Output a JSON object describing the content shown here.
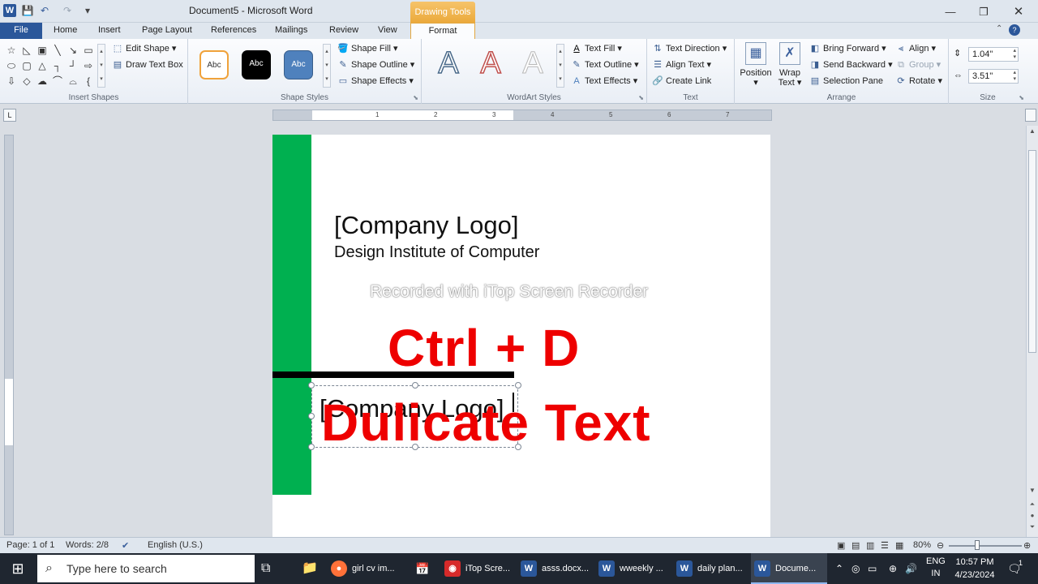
{
  "window": {
    "title": "Document5  -  Microsoft Word",
    "context_tab": "Drawing Tools",
    "minimize": "—",
    "maximize": "❐",
    "close": "✕"
  },
  "tabs": [
    "File",
    "Home",
    "Insert",
    "Page Layout",
    "References",
    "Mailings",
    "Review",
    "View",
    "Format"
  ],
  "ribbon": {
    "insert_shapes": {
      "label": "Insert Shapes",
      "edit_shape": "Edit Shape",
      "draw_text_box": "Draw Text Box"
    },
    "shape_styles": {
      "label": "Shape Styles",
      "sample": "Abc",
      "shape_fill": "Shape Fill",
      "shape_outline": "Shape Outline",
      "shape_effects": "Shape Effects"
    },
    "wordart_styles": {
      "label": "WordArt Styles",
      "letter": "A",
      "text_fill": "Text Fill",
      "text_outline": "Text Outline",
      "text_effects": "Text Effects"
    },
    "text": {
      "label": "Text",
      "text_direction": "Text Direction",
      "align_text": "Align Text",
      "create_link": "Create Link"
    },
    "arrange": {
      "label": "Arrange",
      "position": "Position",
      "wrap_text_1": "Wrap",
      "wrap_text_2": "Text",
      "bring_forward": "Bring Forward",
      "send_backward": "Send Backward",
      "selection_pane": "Selection Pane",
      "align": "Align",
      "group": "Group",
      "rotate": "Rotate"
    },
    "size": {
      "label": "Size",
      "height": "1.04\"",
      "width": "3.51\""
    }
  },
  "ruler": {
    "numbers": [
      "1",
      "2",
      "3",
      "4",
      "5",
      "6",
      "7"
    ]
  },
  "document": {
    "logo": "[Company Logo]",
    "company": "Design Institute of Computer",
    "watermark": "Recorded with iTop Screen Recorder",
    "overlay_shortcut": "Ctrl + D",
    "duplicate_logo": "[Company Logo]",
    "overlay_caption": "Dulicate Text",
    "colors": {
      "green_bar": "#00b050",
      "overlay_red": "#ee0000"
    }
  },
  "statusbar": {
    "page": "Page: 1 of 1",
    "words": "Words: 2/8",
    "language": "English (U.S.)",
    "zoom": "80%"
  },
  "taskbar": {
    "search_placeholder": "Type here to search",
    "apps": [
      {
        "label": "girl cv im...",
        "icon": "firefox-icon"
      },
      {
        "label": "iTop Scre...",
        "icon": "itop-icon"
      },
      {
        "label": "asss.docx...",
        "icon": "word-icon"
      },
      {
        "label": "wweekly ...",
        "icon": "word-icon"
      },
      {
        "label": "daily plan...",
        "icon": "word-icon"
      },
      {
        "label": "Docume...",
        "icon": "word-icon"
      }
    ],
    "lang_1": "ENG",
    "lang_2": "IN",
    "time": "10:57 PM",
    "date": "4/23/2024",
    "notification_count": "1"
  }
}
